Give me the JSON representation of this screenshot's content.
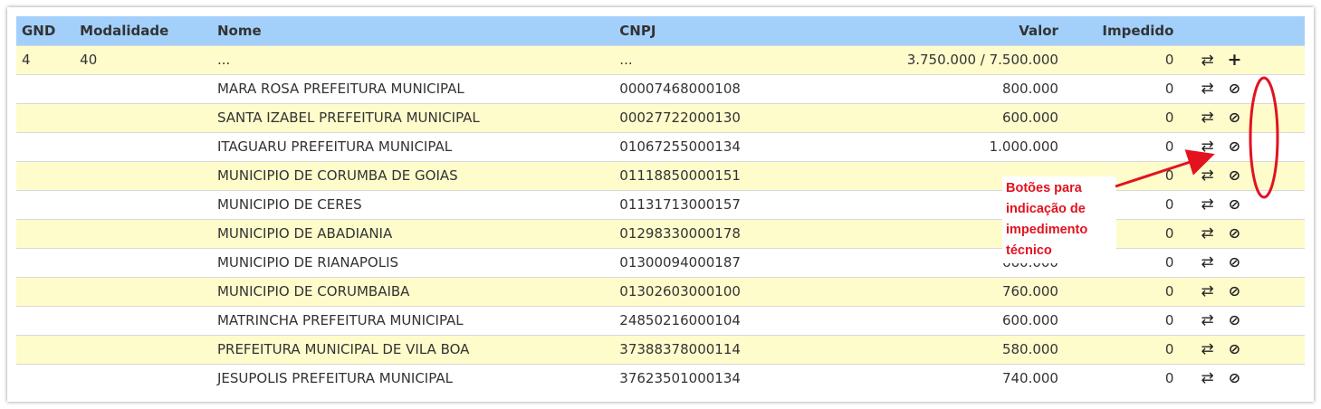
{
  "table": {
    "headers": {
      "gnd": "GND",
      "modalidade": "Modalidade",
      "nome": "Nome",
      "cnpj": "CNPJ",
      "valor": "Valor",
      "impedido": "Impedido"
    },
    "summary_row": {
      "gnd": "4",
      "modalidade": "40",
      "nome": "...",
      "cnpj": "...",
      "valor": "3.750.000 / 7.500.000",
      "impedido": "0"
    },
    "rows": [
      {
        "nome": "MARA ROSA PREFEITURA MUNICIPAL",
        "cnpj": "00007468000108",
        "valor": "800.000",
        "impedido": "0"
      },
      {
        "nome": "SANTA IZABEL PREFEITURA MUNICIPAL",
        "cnpj": "00027722000130",
        "valor": "600.000",
        "impedido": "0"
      },
      {
        "nome": "ITAGUARU PREFEITURA MUNICIPAL",
        "cnpj": "01067255000134",
        "valor": "1.000.000",
        "impedido": "0"
      },
      {
        "nome": "MUNICIPIO DE CORUMBA DE GOIAS",
        "cnpj": "01118850000151",
        "valor": "",
        "impedido": "0"
      },
      {
        "nome": "MUNICIPIO DE CERES",
        "cnpj": "01131713000157",
        "valor": "",
        "impedido": "0"
      },
      {
        "nome": "MUNICIPIO DE ABADIANIA",
        "cnpj": "01298330000178",
        "valor": "",
        "impedido": "0"
      },
      {
        "nome": "MUNICIPIO DE RIANAPOLIS",
        "cnpj": "01300094000187",
        "valor": "660.000",
        "impedido": "0"
      },
      {
        "nome": "MUNICIPIO DE CORUMBAIBA",
        "cnpj": "01302603000100",
        "valor": "760.000",
        "impedido": "0"
      },
      {
        "nome": "MATRINCHA PREFEITURA MUNICIPAL",
        "cnpj": "24850216000104",
        "valor": "600.000",
        "impedido": "0"
      },
      {
        "nome": "PREFEITURA MUNICIPAL DE VILA BOA",
        "cnpj": "37388378000114",
        "valor": "580.000",
        "impedido": "0"
      },
      {
        "nome": "JESUPOLIS PREFEITURA MUNICIPAL",
        "cnpj": "37623501000134",
        "valor": "740.000",
        "impedido": "0"
      }
    ],
    "icons": {
      "swap": "swap-arrows-icon",
      "block": "block-icon",
      "add": "plus-icon"
    }
  },
  "annotation": {
    "line1": "Botões para",
    "line2": "indicação de",
    "line3": "impedimento",
    "line4": "técnico"
  },
  "colors": {
    "header_bg": "#a3d0fb",
    "stripe_bg": "#fffccc",
    "annotation": "#e2121f"
  }
}
